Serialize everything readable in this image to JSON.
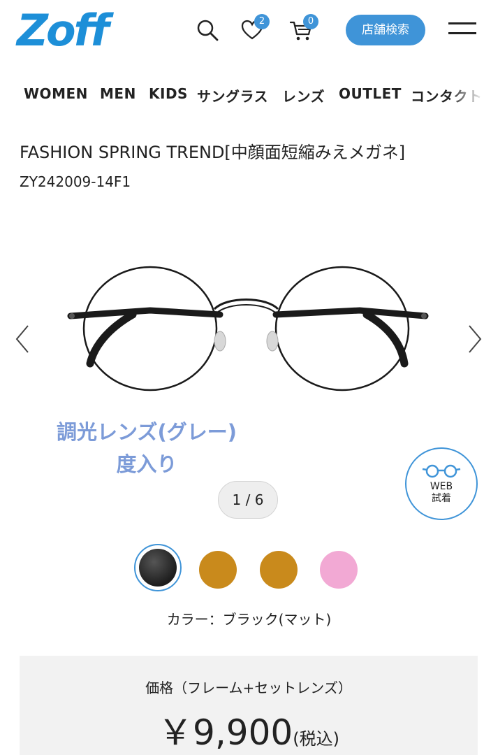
{
  "header": {
    "logo": "Zoff",
    "favorites_count": "2",
    "cart_count": "0",
    "store_search_label": "店舗検索"
  },
  "nav": {
    "items": [
      "WOMEN",
      "MEN",
      "KIDS",
      "サングラス",
      "レンズ",
      "OUTLET",
      "コンタクト"
    ]
  },
  "product": {
    "title": "FASHION SPRING TREND[中顔面短縮みえメガネ]",
    "code": "ZY242009-14F1",
    "image_caption_line1": "調光レンズ(グレー)",
    "image_caption_line2": "度入り",
    "image_counter": "1 / 6",
    "web_try_line1": "WEB",
    "web_try_line2": "試着",
    "color_label": "カラー：ブラック(マット)",
    "swatches": [
      {
        "name": "black",
        "color": "#2a2a2a",
        "selected": true
      },
      {
        "name": "brown-1",
        "color": "#c98a1c",
        "selected": false
      },
      {
        "name": "brown-2",
        "color": "#c98a1c",
        "selected": false
      },
      {
        "name": "pink",
        "color": "#f2a9d4",
        "selected": false
      }
    ]
  },
  "price": {
    "title": "価格（フレーム+セットレンズ）",
    "amount": "￥9,900",
    "tax_note": "(税込)"
  },
  "colors": {
    "accent": "#3f94d8",
    "logo": "#1d8fd8",
    "caption": "#7c9bd8"
  }
}
